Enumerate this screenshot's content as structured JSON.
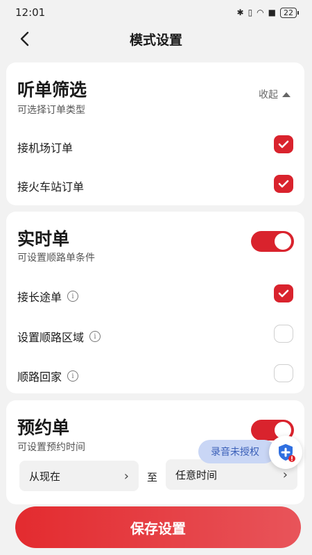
{
  "status_bar": {
    "time": "12:01",
    "battery": "22"
  },
  "nav": {
    "title": "模式设置"
  },
  "listen_filter": {
    "title": "听单筛选",
    "subtitle": "可选择订单类型",
    "collapse_label": "收起",
    "items": [
      {
        "label": "接机场订单",
        "checked": true
      },
      {
        "label": "接火车站订单",
        "checked": true
      }
    ]
  },
  "realtime": {
    "title": "实时单",
    "subtitle": "可设置顺路单条件",
    "enabled": true,
    "items": [
      {
        "label": "接长途单",
        "checked": true
      },
      {
        "label": "设置顺路区域",
        "checked": false
      },
      {
        "label": "顺路回家",
        "checked": false
      }
    ]
  },
  "reservation": {
    "title": "预约单",
    "subtitle": "可设置预约时间",
    "enabled": true,
    "from_label": "从现在",
    "to_label": "至",
    "until_label": "任意时间"
  },
  "floating": {
    "recording_label": "录音未授权"
  },
  "footer": {
    "save_label": "保存设置"
  },
  "colors": {
    "accent": "#d9232d",
    "background": "#f2f2f2"
  }
}
